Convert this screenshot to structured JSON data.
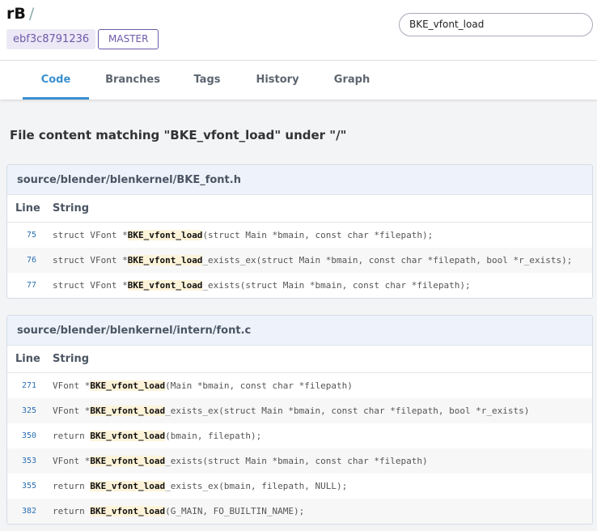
{
  "header": {
    "repo": "rB",
    "separator": "/",
    "commit": "ebf3c8791236",
    "branch": "MASTER",
    "search_value": "BKE_vfont_load"
  },
  "tabs": [
    {
      "label": "Code",
      "active": true
    },
    {
      "label": "Branches"
    },
    {
      "label": "Tags"
    },
    {
      "label": "History"
    },
    {
      "label": "Graph"
    }
  ],
  "title": "File content matching \"BKE_vfont_load\" under \"/\"",
  "columns": {
    "line": "Line",
    "string": "String"
  },
  "results": [
    {
      "file": "source/blender/blenkernel/BKE_font.h",
      "rows": [
        {
          "line": "75",
          "pre": "struct VFont *",
          "match": "BKE_vfont_load",
          "post": "(struct Main *bmain, const char *filepath);"
        },
        {
          "line": "76",
          "pre": "struct VFont *",
          "match": "BKE_vfont_load",
          "post": "_exists_ex(struct Main *bmain, const char *filepath, bool *r_exists);"
        },
        {
          "line": "77",
          "pre": "struct VFont *",
          "match": "BKE_vfont_load",
          "post": "_exists(struct Main *bmain, const char *filepath);"
        }
      ]
    },
    {
      "file": "source/blender/blenkernel/intern/font.c",
      "rows": [
        {
          "line": "271",
          "pre": "VFont *",
          "match": "BKE_vfont_load",
          "post": "(Main *bmain, const char *filepath)"
        },
        {
          "line": "325",
          "pre": "VFont *",
          "match": "BKE_vfont_load",
          "post": "_exists_ex(struct Main *bmain, const char *filepath, bool *r_exists)"
        },
        {
          "line": "350",
          "pre": "return ",
          "match": "BKE_vfont_load",
          "post": "(bmain, filepath);"
        },
        {
          "line": "353",
          "pre": "VFont *",
          "match": "BKE_vfont_load",
          "post": "_exists(struct Main *bmain, const char *filepath)"
        },
        {
          "line": "355",
          "pre": "return ",
          "match": "BKE_vfont_load",
          "post": "_exists_ex(bmain, filepath, NULL);"
        },
        {
          "line": "382",
          "pre": "return ",
          "match": "BKE_vfont_load",
          "post": "(G_MAIN, FO_BUILTIN_NAME);"
        }
      ]
    }
  ]
}
